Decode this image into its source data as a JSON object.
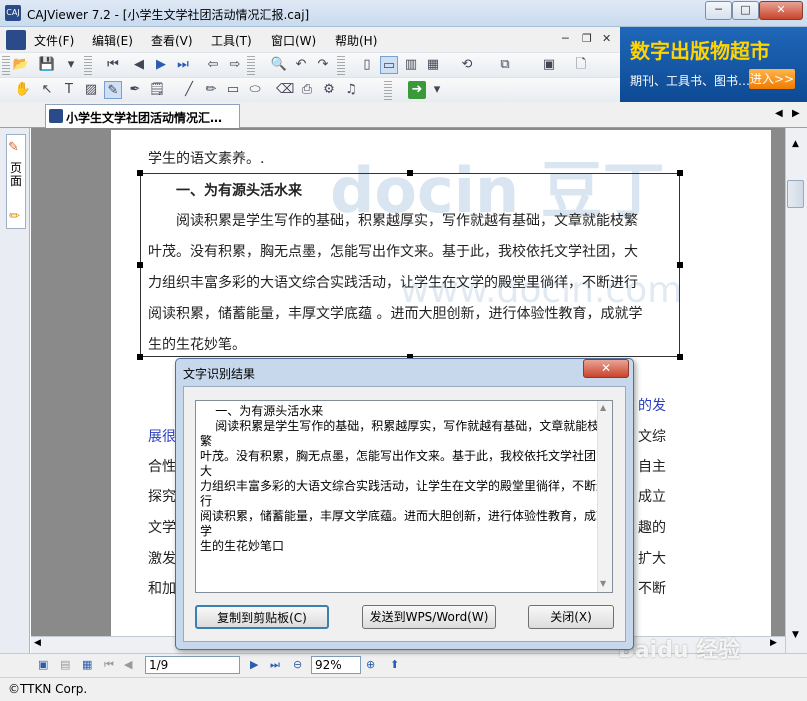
{
  "window": {
    "title": "CAJViewer 7.2 - [小学生文学社团活动情况汇报.caj]",
    "app_icon_text": "CAJ",
    "minimize": "─",
    "maximize": "□",
    "close": "✕"
  },
  "menu": {
    "items": [
      "文件(F)",
      "编辑(E)",
      "查看(V)",
      "工具(T)",
      "窗口(W)",
      "帮助(H)"
    ],
    "mdi_minimize": "─",
    "mdi_restore": "❐",
    "mdi_close": "✕"
  },
  "ad": {
    "title": "数字出版物超市",
    "subtitle": "期刊、工具书、图书…",
    "enter": "进入>>"
  },
  "tab": {
    "label": "小学生文学社团活动情况汇…",
    "prev": "◀",
    "next": "▶"
  },
  "side_panel": {
    "label": "页面"
  },
  "document": {
    "lines": [
      "学生的语文素养。.",
      "一、为有源头活水来",
      "阅读积累是学生写作的基础，积累越厚实，写作就越有基础，文章就能枝繁",
      "叶茂。没有积累，胸无点墨，怎能写出作文来。基于此，我校依托文学社团，大",
      "力组织丰富多彩的大语文综合实践活动，让学生在文学的殿堂里徜徉，不断进行",
      "阅读积累，储蓄能量，丰厚文学底蕴 。进而大胆创新，进行体验性教育，成就学",
      "生的生花妙笔。"
    ],
    "right_fragments": [
      "的发",
      "文综",
      "自主",
      "成立",
      "趣的",
      "扩大",
      "不断"
    ],
    "left_fragments": [
      "展很",
      "合性",
      "探究",
      "文学",
      "激发",
      "和加"
    ],
    "watermark": "docin 豆丁",
    "watermark2": "www.docin.com"
  },
  "dialog": {
    "title": "文字识别结果",
    "close": "✕",
    "recognized_text": "    一、为有源头活水来\n    阅读积累是学生写作的基础，积累越厚实，写作就越有基础，文章就能枝繁\n叶茂。没有积累，胸无点墨，怎能写出作文来。基于此，我校依托文学社团，大\n力组织丰富多彩的大语文综合实践活动，让学生在文学的殿堂里徜徉，不断进行\n阅读积累，储蓄能量，丰厚文学底蕴。进而大胆创新，进行体验性教育，成就学\n生的生花妙笔口",
    "buttons": {
      "copy": "复制到剪贴板(C)",
      "send": "发送到WPS/Word(W)",
      "close": "关闭(X)"
    }
  },
  "nav": {
    "page": "1/9",
    "zoom": "92%"
  },
  "status": {
    "text": "©TTKN Corp.",
    "baidu": "Baidu 经验"
  }
}
